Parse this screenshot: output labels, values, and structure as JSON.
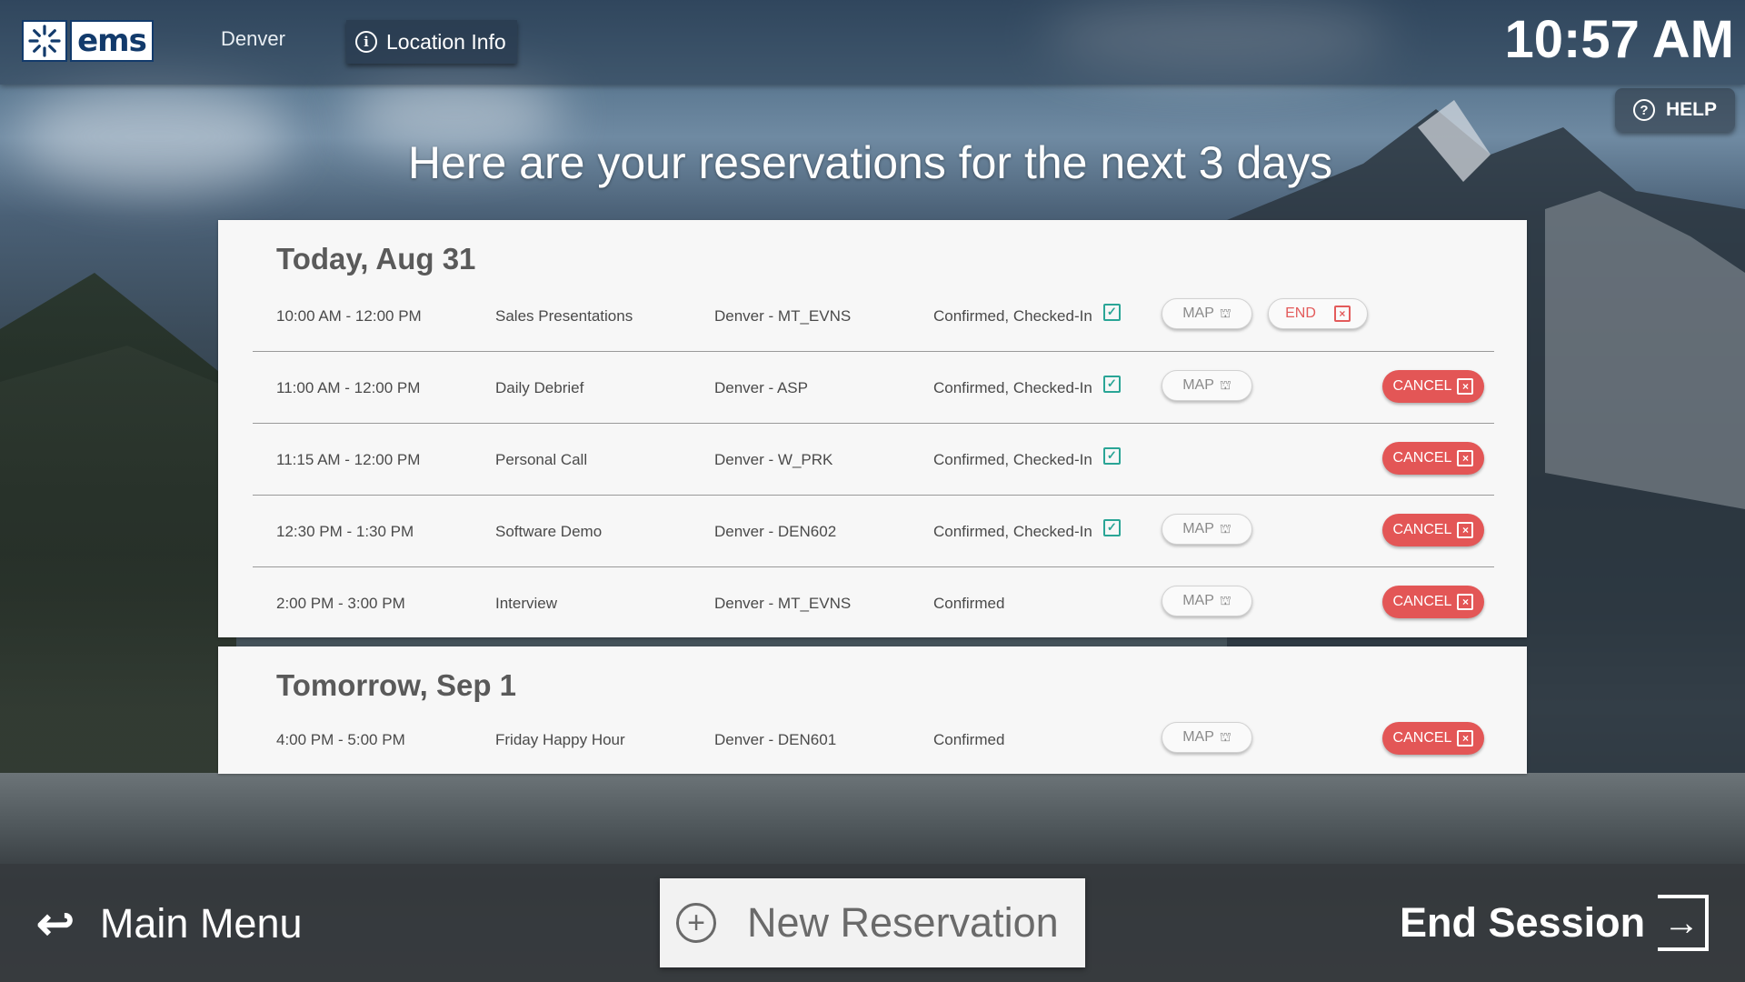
{
  "header": {
    "logo_text": "ems",
    "location": "Denver",
    "location_info_label": "Location Info",
    "clock": "10:57 AM",
    "help_label": "HELP"
  },
  "page_title": "Here are your reservations for the next 3 days",
  "days": [
    {
      "heading": "Today, Aug 31",
      "reservations": [
        {
          "time": "10:00 AM - 12:00 PM",
          "title": "Sales Presentations",
          "location": "Denver - MT_EVNS",
          "status": "Confirmed, Checked-In",
          "checked_in": true,
          "map_label": "MAP",
          "action_label": "END",
          "action": "end"
        },
        {
          "time": "11:00 AM - 12:00 PM",
          "title": "Daily Debrief",
          "location": "Denver - ASP",
          "status": "Confirmed, Checked-In",
          "checked_in": true,
          "map_label": "MAP",
          "action_label": "CANCEL",
          "action": "cancel"
        },
        {
          "time": "11:15 AM - 12:00 PM",
          "title": "Personal Call",
          "location": "Denver - W_PRK",
          "status": "Confirmed, Checked-In",
          "checked_in": true,
          "map_label": "",
          "action_label": "CANCEL",
          "action": "cancel"
        },
        {
          "time": "12:30 PM - 1:30 PM",
          "title": "Software Demo",
          "location": "Denver - DEN602",
          "status": "Confirmed, Checked-In",
          "checked_in": true,
          "map_label": "MAP",
          "action_label": "CANCEL",
          "action": "cancel"
        },
        {
          "time": "2:00 PM - 3:00 PM",
          "title": "Interview",
          "location": "Denver - MT_EVNS",
          "status": "Confirmed",
          "checked_in": false,
          "map_label": "MAP",
          "action_label": "CANCEL",
          "action": "cancel"
        }
      ]
    },
    {
      "heading": "Tomorrow, Sep 1",
      "reservations": [
        {
          "time": "4:00 PM - 5:00 PM",
          "title": "Friday Happy Hour",
          "location": "Denver - DEN601",
          "status": "Confirmed",
          "checked_in": false,
          "map_label": "MAP",
          "action_label": "CANCEL",
          "action": "cancel"
        }
      ]
    }
  ],
  "footer": {
    "main_menu_label": "Main Menu",
    "new_reservation_label": "New Reservation",
    "end_session_label": "End Session"
  },
  "colors": {
    "cancel_red": "#e35656",
    "checked_in_teal": "#2aa596",
    "logo_blue": "#123a6b"
  },
  "icons": {
    "logo": "ems-burst-logo-icon",
    "location_info": "info-circle-icon",
    "help": "question-circle-icon",
    "checked_in": "calendar-check-icon",
    "map": "map-pin-icon",
    "cancel": "calendar-x-icon",
    "main_menu": "return-arrow-icon",
    "new_reservation": "plus-circle-icon",
    "end_session": "exit-door-icon"
  }
}
